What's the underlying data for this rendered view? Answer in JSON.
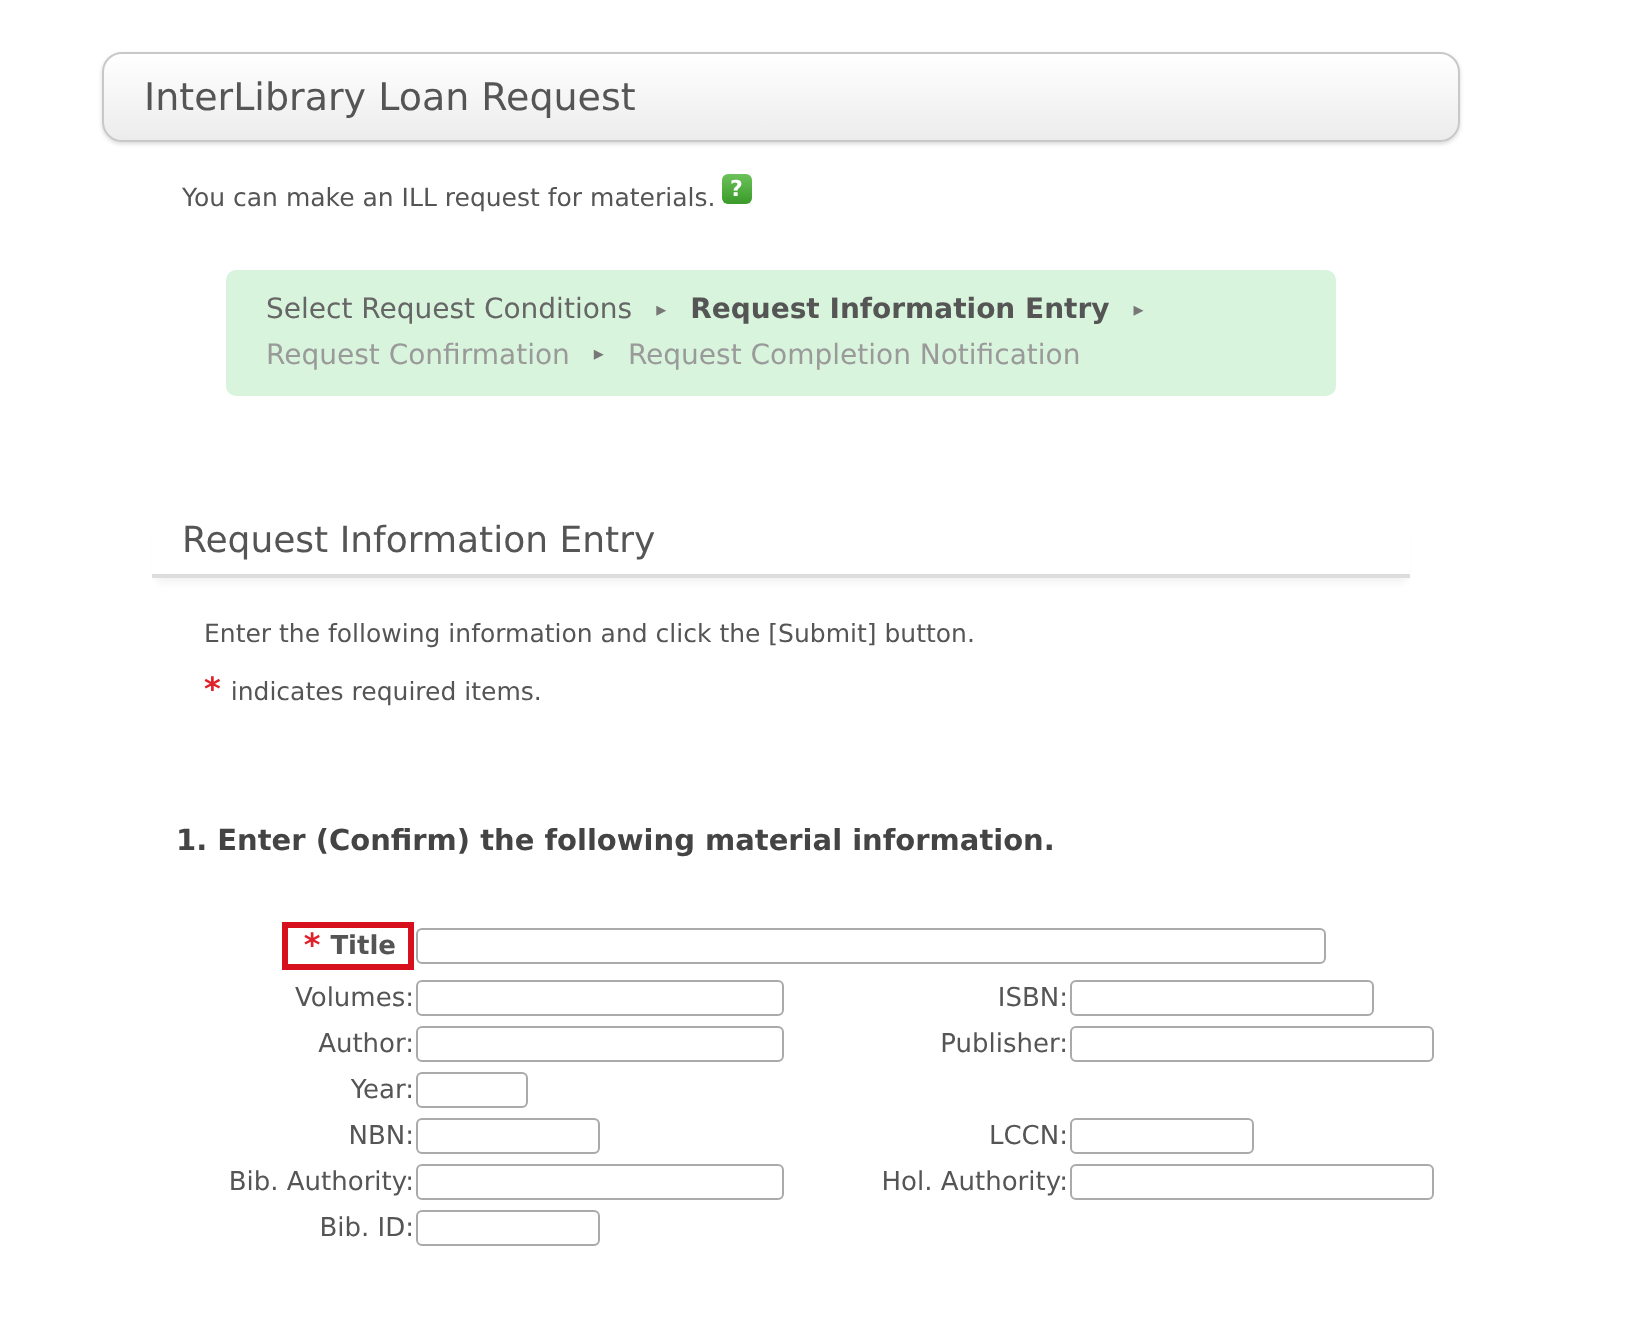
{
  "header": {
    "title": "InterLibrary Loan Request"
  },
  "intro": {
    "text": "You can make an ILL request for materials.",
    "help_icon": "?"
  },
  "steps": [
    {
      "label": "Select Request Conditions",
      "selected": false,
      "disabled": false
    },
    {
      "label": "Request Information Entry",
      "selected": true,
      "disabled": false
    },
    {
      "label": "Request Confirmation",
      "selected": false,
      "disabled": true
    },
    {
      "label": "Request Completion Notification",
      "selected": false,
      "disabled": true
    }
  ],
  "step_separator": "▸",
  "section": {
    "title": "Request Information Entry",
    "instruction": "Enter the following information and click the [Submit] button.",
    "required_mark": "*",
    "required_note": "indicates required items."
  },
  "subsection": {
    "title": "1. Enter (Confirm) the following material information."
  },
  "rows": [
    {
      "left": {
        "label": "Title",
        "required": true,
        "highlighted": true
      }
    },
    {
      "left": {
        "label": "Volumes:",
        "required": false,
        "highlighted": false
      },
      "right": {
        "label": "ISBN:",
        "required": false,
        "highlighted": false
      }
    },
    {
      "left": {
        "label": "Author:",
        "required": false,
        "highlighted": false
      },
      "right": {
        "label": "Publisher:",
        "required": false,
        "highlighted": false
      }
    },
    {
      "left": {
        "label": "Year:",
        "required": false,
        "highlighted": false
      }
    },
    {
      "left": {
        "label": "NBN:",
        "required": false,
        "highlighted": false
      },
      "right": {
        "label": "LCCN:",
        "required": false,
        "highlighted": false
      }
    },
    {
      "left": {
        "label": "Bib. Authority:",
        "required": false,
        "highlighted": false
      },
      "right": {
        "label": "Hol. Authority:",
        "required": false,
        "highlighted": false
      }
    },
    {
      "left": {
        "label": "Bib. ID:",
        "required": false,
        "highlighted": false
      }
    }
  ]
}
